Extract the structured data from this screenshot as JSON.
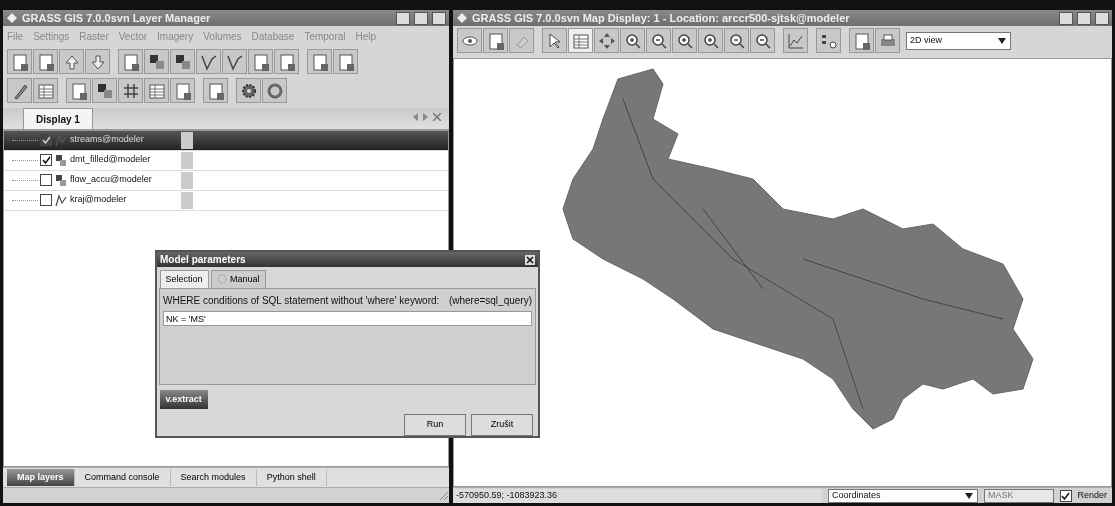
{
  "layer_manager": {
    "title": "GRASS GIS 7.0.0svn Layer Manager",
    "menu": [
      "File",
      "Settings",
      "Raster",
      "Vector",
      "Imagery",
      "Volumes",
      "Database",
      "Temporal",
      "Help"
    ],
    "display_tab": {
      "label": "Display 1",
      "selected": true
    },
    "layers": [
      {
        "name": "streams@modeler",
        "kind": "vector",
        "checked": true,
        "selected": true
      },
      {
        "name": "dmt_filled@modeler",
        "kind": "raster",
        "checked": true,
        "selected": false
      },
      {
        "name": "flow_accu@modeler",
        "kind": "raster",
        "checked": false,
        "selected": false
      },
      {
        "name": "kraj@modeler",
        "kind": "vector",
        "checked": false,
        "selected": false
      }
    ],
    "bottom_tabs": [
      {
        "label": "Map layers",
        "selected": true
      },
      {
        "label": "Command console",
        "selected": false
      },
      {
        "label": "Search modules",
        "selected": false
      },
      {
        "label": "Python shell",
        "selected": false
      }
    ]
  },
  "map_display": {
    "title": "GRASS GIS 7.0.0svn Map Display: 1  - Location: arccr500-sjtsk@modeler",
    "view_select": "2D view",
    "coordinates": "-570950.59; -1083923.36",
    "status_mode": "Coordinates",
    "mask": {
      "label": "MASK",
      "enabled": false
    },
    "render": {
      "label": "Render",
      "checked": true
    }
  },
  "dialog": {
    "title": "Model parameters",
    "tabs": [
      {
        "label": "Selection",
        "selected": true
      },
      {
        "label": "Manual",
        "selected": false
      }
    ],
    "parameter_label": "WHERE conditions of SQL statement without 'where' keyword:",
    "parameter_key": "(where=sql_query)",
    "value": "NK = 'MS'",
    "module_tab": "v.extract",
    "buttons": [
      "Run",
      "Zrušit"
    ]
  }
}
